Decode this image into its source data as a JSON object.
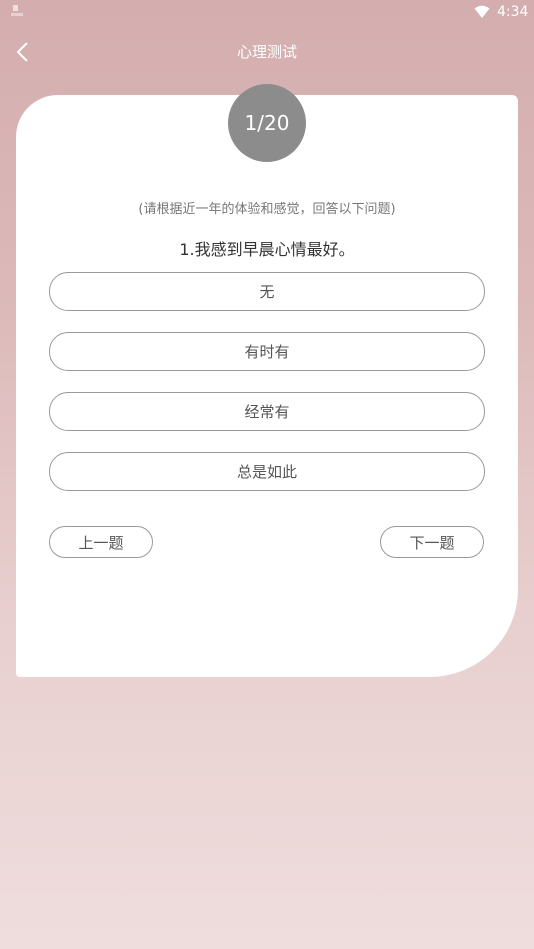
{
  "status_bar": {
    "time": "4:34",
    "app_icon": "notification-app-icon",
    "wifi_icon": "wifi-icon"
  },
  "header": {
    "title": "心理测试",
    "back_icon": "chevron-left-icon"
  },
  "quiz": {
    "progress": "1/20",
    "instruction": "(请根据近一年的体验和感觉，回答以下问题)",
    "question": "1.我感到早晨心情最好。",
    "options": [
      "无",
      "有时有",
      "经常有",
      "总是如此"
    ],
    "prev_label": "上一题",
    "next_label": "下一题"
  },
  "colors": {
    "background_top": "#d4aeae",
    "background_bottom": "#efdddd",
    "progress_circle": "#8c8c8c",
    "card": "#ffffff"
  }
}
